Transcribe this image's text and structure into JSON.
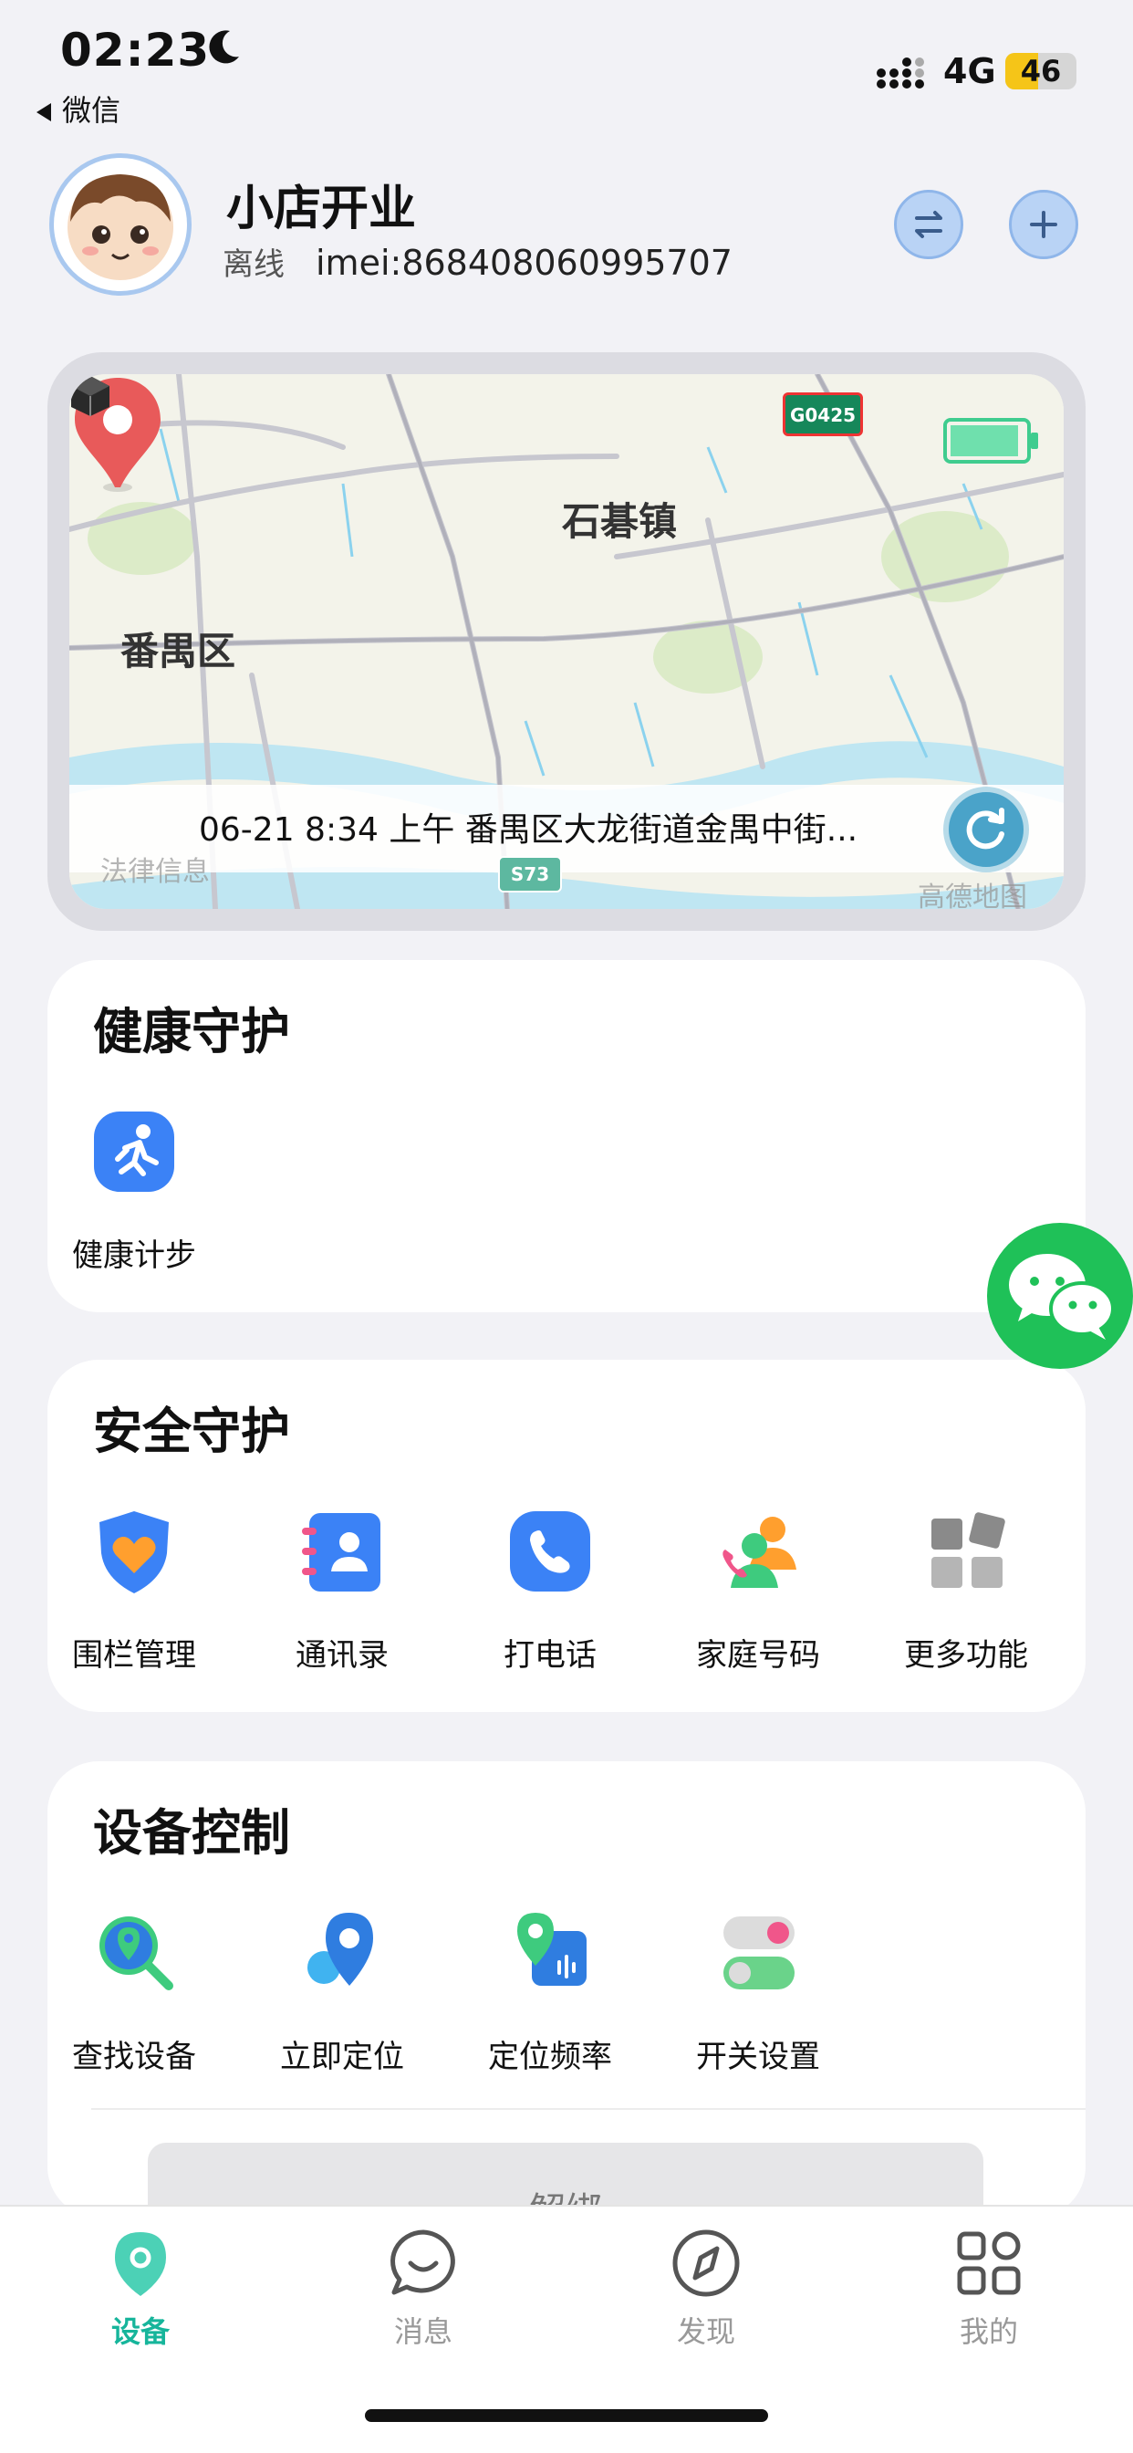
{
  "status_bar": {
    "time": "02:23",
    "back_app": "微信",
    "network": "4G",
    "battery": "46",
    "battery_percent": 46
  },
  "header": {
    "title": "小店开业",
    "online_status": "离线",
    "imei": "imei:868408060995707"
  },
  "map": {
    "labels": {
      "town": "石碁镇",
      "district": "番禺区"
    },
    "road_badges": [
      "G0425",
      "S73"
    ],
    "address": "06-21 8:34 上午 番禺区大龙街道金禺中街...",
    "watermark_left": "法律信息",
    "watermark_right": "高德地图"
  },
  "sections": {
    "health": {
      "title": "健康守护",
      "items": [
        {
          "label": "健康计步",
          "icon": "running-icon"
        }
      ]
    },
    "safety": {
      "title": "安全守护",
      "items": [
        {
          "label": "围栏管理",
          "icon": "shield-heart-icon"
        },
        {
          "label": "通讯录",
          "icon": "contacts-icon"
        },
        {
          "label": "打电话",
          "icon": "phone-icon"
        },
        {
          "label": "家庭号码",
          "icon": "family-call-icon"
        },
        {
          "label": "更多功能",
          "icon": "grid-more-icon"
        }
      ]
    },
    "control": {
      "title": "设备控制",
      "items": [
        {
          "label": "查找设备",
          "icon": "find-device-icon"
        },
        {
          "label": "立即定位",
          "icon": "locate-now-icon"
        },
        {
          "label": "定位频率",
          "icon": "location-frequency-icon"
        },
        {
          "label": "开关设置",
          "icon": "toggle-settings-icon"
        }
      ]
    }
  },
  "unbind_label": "解绑",
  "tabbar": {
    "tabs": [
      {
        "label": "设备",
        "icon": "device-pin-icon",
        "active": true
      },
      {
        "label": "消息",
        "icon": "message-icon",
        "active": false
      },
      {
        "label": "发现",
        "icon": "compass-icon",
        "active": false
      },
      {
        "label": "我的",
        "icon": "grid-icon",
        "active": false
      }
    ]
  },
  "colors": {
    "accent": "#16b59b",
    "blue": "#3b82f6",
    "wechat_green": "#1fc158"
  }
}
